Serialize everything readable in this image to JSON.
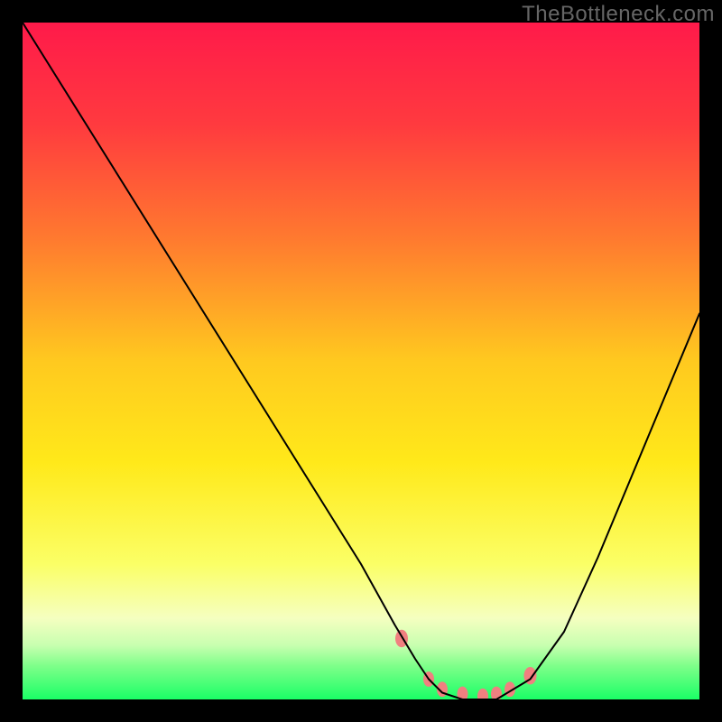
{
  "watermark": "TheBottleneck.com",
  "chart_data": {
    "type": "line",
    "title": "",
    "xlabel": "",
    "ylabel": "",
    "xlim": [
      0,
      100
    ],
    "ylim": [
      0,
      100
    ],
    "background_gradient": {
      "stops": [
        {
          "offset": 0,
          "color": "#ff1a4a"
        },
        {
          "offset": 15,
          "color": "#ff3a3f"
        },
        {
          "offset": 32,
          "color": "#ff7a2f"
        },
        {
          "offset": 50,
          "color": "#ffc91f"
        },
        {
          "offset": 65,
          "color": "#ffe91a"
        },
        {
          "offset": 80,
          "color": "#fbff66"
        },
        {
          "offset": 88,
          "color": "#f5ffc0"
        },
        {
          "offset": 92,
          "color": "#c8ffb0"
        },
        {
          "offset": 95,
          "color": "#7fff8a"
        },
        {
          "offset": 100,
          "color": "#1aff66"
        }
      ]
    },
    "series": [
      {
        "name": "curve",
        "color": "#000000",
        "stroke_width": 2,
        "x": [
          0,
          5,
          10,
          15,
          20,
          25,
          30,
          35,
          40,
          45,
          50,
          55,
          58,
          60,
          62,
          65,
          68,
          70,
          75,
          80,
          85,
          90,
          95,
          100
        ],
        "y": [
          100,
          92,
          84,
          76,
          68,
          60,
          52,
          44,
          36,
          28,
          20,
          11,
          6,
          3,
          1,
          0,
          0,
          0,
          3,
          10,
          21,
          33,
          45,
          57
        ]
      }
    ],
    "markers": [
      {
        "name": "dot",
        "x": 56,
        "y": 9,
        "r": 7,
        "color": "#f08080"
      },
      {
        "name": "dot",
        "x": 60,
        "y": 3,
        "r": 6,
        "color": "#f08080"
      },
      {
        "name": "dot",
        "x": 62,
        "y": 1.5,
        "r": 6,
        "color": "#f08080"
      },
      {
        "name": "dot",
        "x": 65,
        "y": 0.8,
        "r": 6,
        "color": "#f08080"
      },
      {
        "name": "dot",
        "x": 68,
        "y": 0.5,
        "r": 6,
        "color": "#f08080"
      },
      {
        "name": "dot",
        "x": 70,
        "y": 0.8,
        "r": 6,
        "color": "#f08080"
      },
      {
        "name": "dot",
        "x": 72,
        "y": 1.5,
        "r": 6,
        "color": "#f08080"
      },
      {
        "name": "dot",
        "x": 75,
        "y": 3.5,
        "r": 7,
        "color": "#f08080"
      }
    ]
  }
}
